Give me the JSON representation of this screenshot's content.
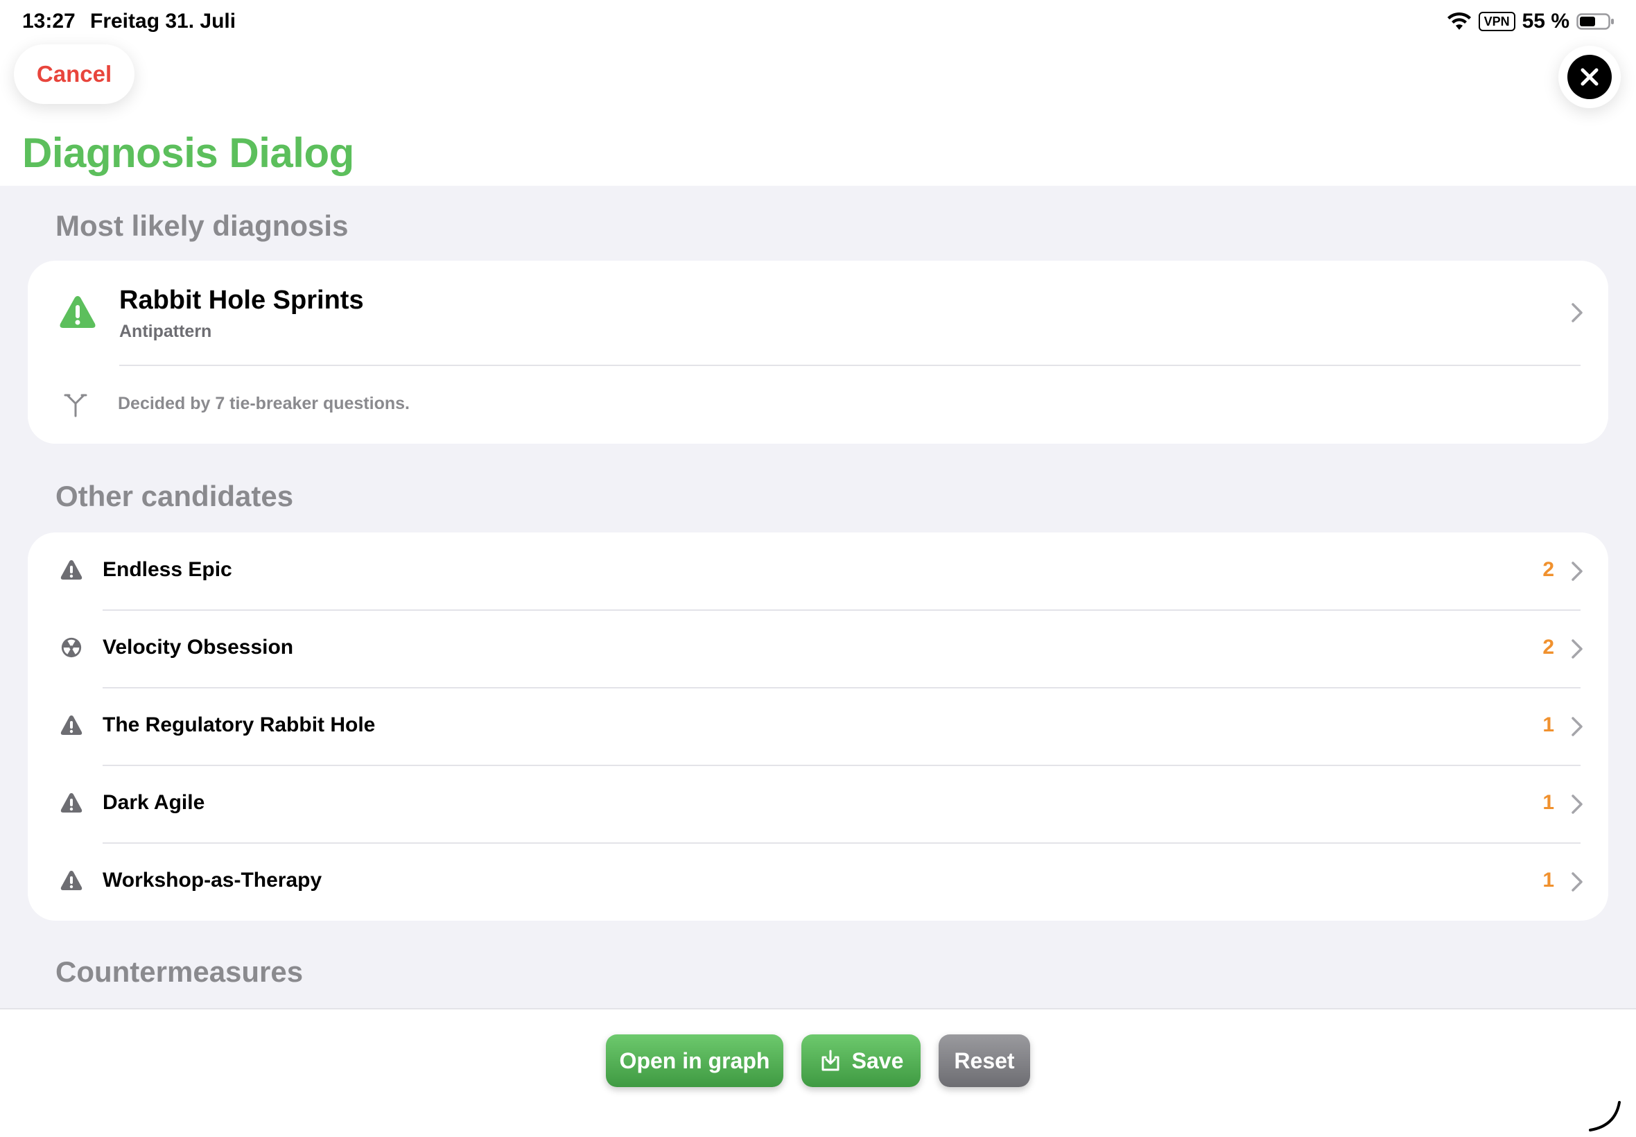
{
  "status_bar": {
    "time": "13:27",
    "date": "Freitag 31. Juli",
    "vpn": "VPN",
    "battery": "55 %"
  },
  "header": {
    "cancel_label": "Cancel",
    "title": "Diagnosis Dialog"
  },
  "primary": {
    "section_title": "Most likely diagnosis",
    "title": "Rabbit Hole Sprints",
    "subtitle": "Antipattern",
    "tiebreak_text": "Decided by 7 tie-breaker questions."
  },
  "candidates": {
    "section_title": "Other candidates",
    "items": [
      {
        "label": "Endless Epic",
        "count": "2",
        "icon": "warning-icon"
      },
      {
        "label": "Velocity Obsession",
        "count": "2",
        "icon": "radiation-icon"
      },
      {
        "label": "The Regulatory Rabbit Hole",
        "count": "1",
        "icon": "warning-icon"
      },
      {
        "label": "Dark Agile",
        "count": "1",
        "icon": "warning-icon"
      },
      {
        "label": "Workshop-as-Therapy",
        "count": "1",
        "icon": "warning-icon"
      }
    ]
  },
  "countermeasures": {
    "section_title": "Countermeasures"
  },
  "actions": {
    "open_graph": "Open in graph",
    "save": "Save",
    "reset": "Reset"
  },
  "colors": {
    "accent_green": "#5cbf5c",
    "cancel_red": "#e8453c",
    "count_orange": "#f0912e"
  }
}
